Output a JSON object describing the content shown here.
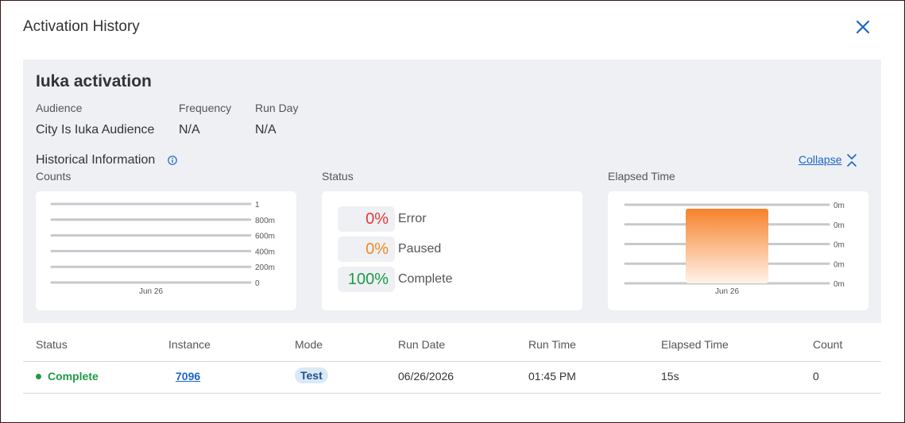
{
  "dialog": {
    "title": "Activation History",
    "close_icon": "close-icon"
  },
  "activation": {
    "name": "Iuka activation",
    "audience_label": "Audience",
    "audience_value": "City Is Iuka Audience",
    "frequency_label": "Frequency",
    "frequency_value": "N/A",
    "run_day_label": "Run Day",
    "run_day_value": "N/A"
  },
  "historical": {
    "title": "Historical Information",
    "info_icon": "info-icon",
    "collapse_label": "Collapse",
    "collapse_icon": "chevrons-collapse-icon"
  },
  "counts_card": {
    "label": "Counts"
  },
  "status_card": {
    "label": "Status",
    "rows": [
      {
        "pct": "0%",
        "label": "Error",
        "color": "#e03a3a"
      },
      {
        "pct": "0%",
        "label": "Paused",
        "color": "#f08a24"
      },
      {
        "pct": "100%",
        "label": "Complete",
        "color": "#1e9a45"
      }
    ]
  },
  "elapsed_card": {
    "label": "Elapsed Time"
  },
  "chart_data": [
    {
      "type": "bar",
      "categories": [
        "Jun 26"
      ],
      "values": [
        0
      ],
      "yticks": [
        "0",
        "200m",
        "400m",
        "600m",
        "800m",
        "1"
      ],
      "ylim": [
        0,
        1
      ]
    },
    {
      "type": "bar",
      "categories": [
        "Jun 26"
      ],
      "values": [
        15
      ],
      "yticks": [
        "0m",
        "0m",
        "0m",
        "0m",
        "0m"
      ],
      "bar_color": "#f7822a"
    }
  ],
  "table": {
    "headers": [
      "Status",
      "Instance",
      "Mode",
      "Run Date",
      "Run Time",
      "Elapsed Time",
      "Count"
    ],
    "rows": [
      {
        "status": "Complete",
        "status_color": "#1e9a45",
        "instance": "7096",
        "mode": "Test",
        "run_date": "06/26/2026",
        "run_time": "01:45 PM",
        "elapsed": "15s",
        "count": "0"
      }
    ]
  },
  "colors": {
    "accent": "#1a66c9",
    "panel_bg": "#eef0f3"
  }
}
